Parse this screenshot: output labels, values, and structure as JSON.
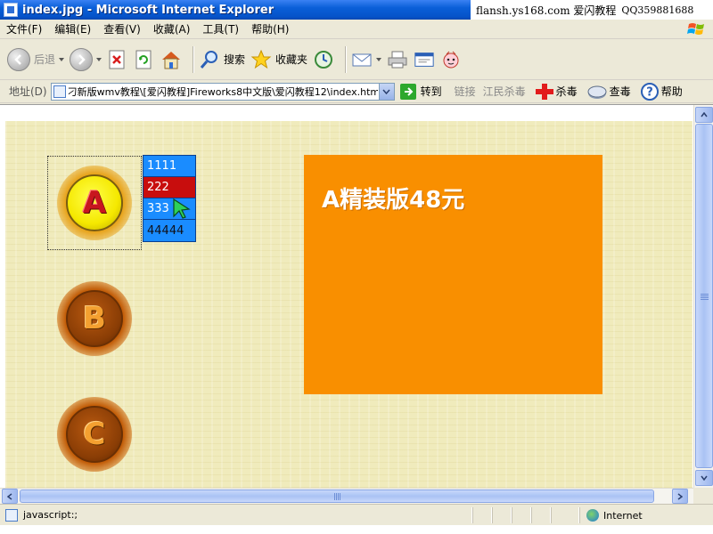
{
  "window": {
    "title": "index.jpg - Microsoft Internet Explorer",
    "watermark": "flansh.ys168.com 爱闪教程",
    "watermark_qq": "QQ359881688"
  },
  "menu": {
    "items": [
      "文件(F)",
      "编辑(E)",
      "查看(V)",
      "收藏(A)",
      "工具(T)",
      "帮助(H)"
    ]
  },
  "toolbar": {
    "back_label": "后退",
    "search_label": "搜索",
    "favorites_label": "收藏夹"
  },
  "address": {
    "label": "地址(D)",
    "value": "刁新版wmv教程\\[爱闪教程]Fireworks8中文版\\爱闪教程12\\index.htm",
    "go_label": "转到",
    "links_label": "链接",
    "jiangmin_label": "江民杀毒",
    "kill_label": "杀毒",
    "scan_label": "查毒",
    "help_label": "帮助"
  },
  "content": {
    "buttons": [
      {
        "letter": "A"
      },
      {
        "letter": "B"
      },
      {
        "letter": "C"
      }
    ],
    "submenu": [
      "1111",
      "222",
      "333",
      "44444"
    ],
    "panel_title": "A精装版48元"
  },
  "status": {
    "text": "javascript:;",
    "zone": "Internet"
  },
  "colors": {
    "panel_orange": "#f98f00",
    "submenu_blue": "#1a8cff",
    "submenu_active_red": "#c80d0d",
    "content_bg": "#f0ebbc"
  }
}
